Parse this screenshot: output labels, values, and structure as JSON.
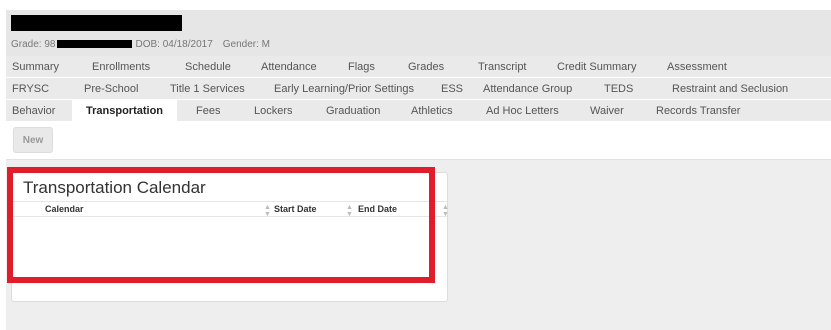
{
  "student": {
    "grade_label": "Grade: 98",
    "dob_label": "DOB: 04/18/2017",
    "gender_label": "Gender: M"
  },
  "tabs_row1": [
    "Summary",
    "Enrollments",
    "Schedule",
    "Attendance",
    "Flags",
    "Grades",
    "Transcript",
    "Credit Summary",
    "Assessment"
  ],
  "tabs_row2": [
    "FRYSC",
    "Pre-School",
    "Title 1 Services",
    "Early Learning/Prior Settings",
    "ESS",
    "Attendance Group",
    "TEDS",
    "Restraint and Seclusion"
  ],
  "tabs_row3": [
    "Behavior",
    "Transportation",
    "Fees",
    "Lockers",
    "Graduation",
    "Athletics",
    "Ad Hoc Letters",
    "Waiver",
    "Records Transfer"
  ],
  "active_tab": "Transportation",
  "toolbar": {
    "new_label": "New"
  },
  "panel": {
    "title": "Transportation Calendar",
    "columns": [
      "Calendar",
      "Start Date",
      "End Date"
    ],
    "rows": []
  },
  "colors": {
    "highlight": "#e11d2b",
    "tab_bg": "#eaeaea",
    "header_bg": "#e6e6e6"
  }
}
